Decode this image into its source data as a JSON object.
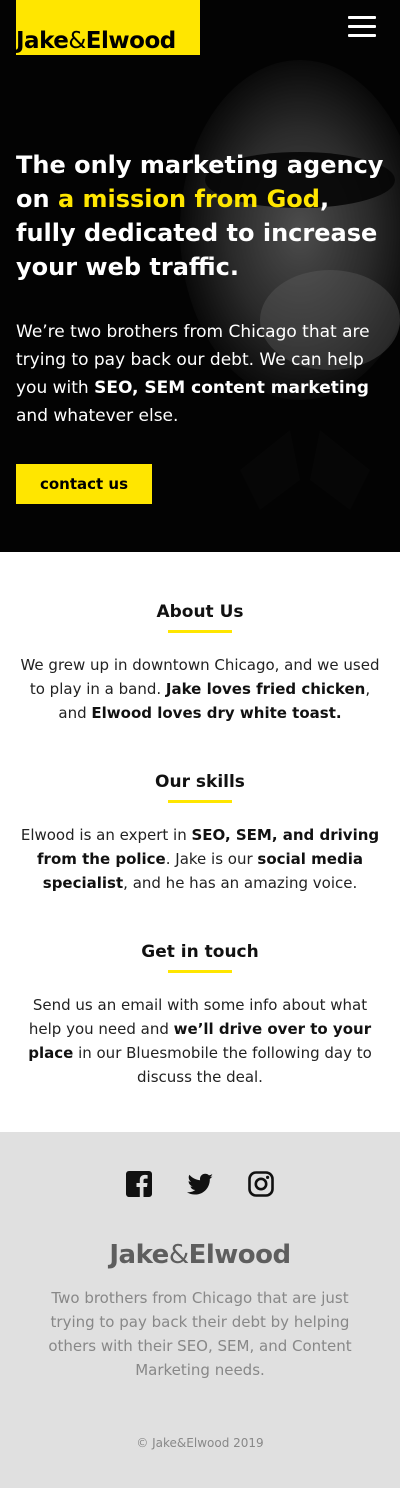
{
  "header": {
    "logo_first": "Jake",
    "logo_amp": "&",
    "logo_second": "Elwood",
    "menu_icon": "hamburger-menu-icon"
  },
  "hero": {
    "headline_part1": "The only marketing agency on ",
    "headline_highlight": "a mission from God",
    "headline_part2": ", fully dedicated to increase your web traffic.",
    "intro_part1": "We’re two brothers from Chicago that are trying to pay back our debt. We can help you with ",
    "intro_bold": "SEO, SEM content marketing",
    "intro_part2": " and whatever else.",
    "cta_label": "contact us"
  },
  "about": {
    "title": "About Us",
    "text_part1": "We grew up in downtown Chicago, and we used to play in a band. ",
    "text_bold1": "Jake loves fried chicken",
    "text_part2": ", and ",
    "text_bold2": "Elwood loves dry white toast."
  },
  "skills": {
    "title": "Our skills",
    "text_part1": "Elwood is an expert in ",
    "text_bold1": "SEO, SEM, and driving from the police",
    "text_part2": ". Jake is our ",
    "text_bold2": "social media specialist",
    "text_part3": ", and he has an amazing voice."
  },
  "contact": {
    "title": "Get in touch",
    "text_part1": "Send us an email with some info about what help you need and ",
    "text_bold1": "we’ll drive over to your place",
    "text_part2": " in our Bluesmobile the following day to discuss the deal."
  },
  "footer": {
    "socials": [
      "facebook-icon",
      "twitter-icon",
      "instagram-icon"
    ],
    "logo_first": "Jake",
    "logo_amp": "&",
    "logo_second": "Elwood",
    "description": "Two brothers from Chicago that are just trying to pay back their debt by helping others with their SEO, SEM, and Content Marketing needs.",
    "copyright": "© Jake&Elwood 2019"
  },
  "colors": {
    "accent": "#ffe600",
    "hero_bg": "#000000",
    "footer_bg": "#e0e0e0"
  }
}
